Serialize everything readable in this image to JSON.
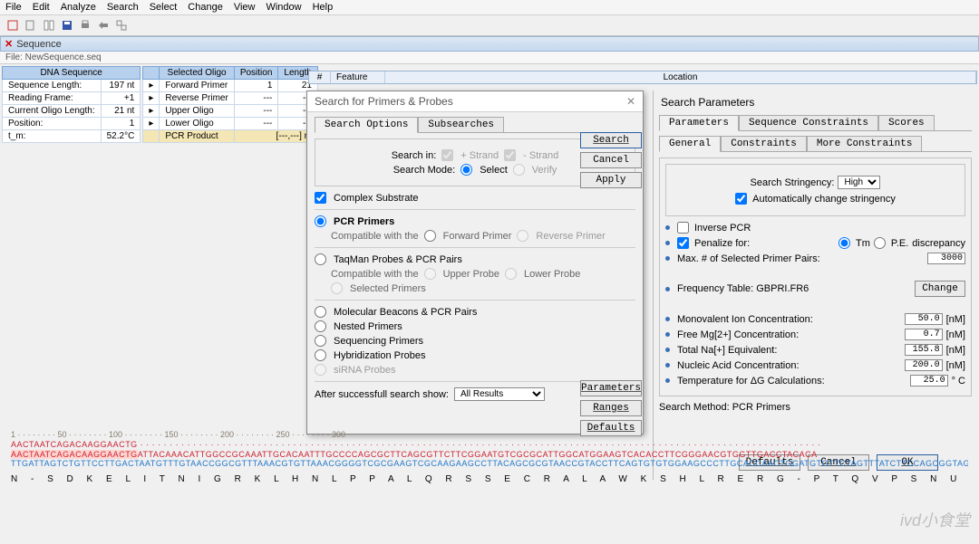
{
  "menu": [
    "File",
    "Edit",
    "Analyze",
    "Search",
    "Select",
    "Change",
    "View",
    "Window",
    "Help"
  ],
  "doc_title": "Sequence",
  "file_label": "File: NewSequence.seq",
  "dna_table": {
    "header": "DNA Sequence",
    "rows": [
      {
        "k": "Sequence Length:",
        "v": "197 nt"
      },
      {
        "k": "Reading Frame:",
        "v": "+1"
      },
      {
        "k": "Current Oligo Length:",
        "v": "21 nt"
      },
      {
        "k": "Position:",
        "v": "1"
      },
      {
        "k": "t_m:",
        "v": "52.2°C"
      }
    ]
  },
  "oligo_table": {
    "headers": [
      "Selected Oligo",
      "Position",
      "Length"
    ],
    "rows": [
      {
        "n": "Forward Primer",
        "p": "1",
        "l": "21"
      },
      {
        "n": "Reverse Primer",
        "p": "---",
        "l": "---"
      },
      {
        "n": "Upper Oligo",
        "p": "---",
        "l": "---"
      },
      {
        "n": "Lower Oligo",
        "p": "---",
        "l": "---"
      },
      {
        "n": "PCR Product",
        "p": "[---,---] nt",
        "l": ""
      }
    ]
  },
  "feat_headers": {
    "num": "#",
    "feature": "Feature",
    "location": "Location"
  },
  "dlg": {
    "title": "Search for Primers & Probes",
    "tab1": "Search Options",
    "tab2": "Subsearches",
    "search_in": "Search in:",
    "plus": "+ Strand",
    "minus": "- Strand",
    "search_mode": "Search Mode:",
    "select": "Select",
    "verify": "Verify",
    "complex": "Complex Substrate",
    "pcr_primers": "PCR Primers",
    "compat": "Compatible with the",
    "fwd": "Forward Primer",
    "rev": "Reverse Primer",
    "taqman": "TaqMan Probes & PCR Pairs",
    "upper": "Upper Probe",
    "lower": "Lower Probe",
    "selp": "Selected Primers",
    "mbeacons": "Molecular Beacons & PCR Pairs",
    "nested": "Nested Primers",
    "seqp": "Sequencing Primers",
    "hybp": "Hybridization Probes",
    "sirna": "siRNA Probes",
    "after": "After successfull search show:",
    "after_v": "All Results",
    "btn_search": "Search",
    "btn_cancel": "Cancel",
    "btn_apply": "Apply",
    "btn_params": "Parameters",
    "btn_ranges": "Ranges",
    "btn_defaults": "Defaults"
  },
  "sp": {
    "title": "Search Parameters",
    "tabs": [
      "Parameters",
      "Sequence Constraints",
      "Scores"
    ],
    "subtabs": [
      "General",
      "Constraints",
      "More Constraints"
    ],
    "stringency_l": "Search Stringency:",
    "stringency_v": "High",
    "auto": "Automatically change stringency",
    "inverse": "Inverse PCR",
    "penalize": "Penalize for:",
    "tm": "Tm",
    "pe": "P.E.",
    "disc": "discrepancy",
    "maxpairs": "Max. # of Selected Primer Pairs:",
    "maxpairs_v": "3000",
    "freq": "Frequency Table:  GBPRI.FR6",
    "change": "Change",
    "mono": "Monovalent Ion Concentration:",
    "mono_v": "50.0",
    "mono_u": "[nM]",
    "mg": "Free Mg[2+] Concentration:",
    "mg_v": "0.7",
    "mg_u": "[nM]",
    "na": "Total Na[+] Equivalent:",
    "na_v": "155.8",
    "na_u": "[nM]",
    "nucleic": "Nucleic Acid Concentration:",
    "nucleic_v": "200.0",
    "nucleic_u": "[nM]",
    "temp": "Temperature for ΔG Calculations:",
    "temp_v": "25.0",
    "temp_u": "° C",
    "method": "Search Method:  PCR Primers",
    "btn_def": "Defaults",
    "btn_can": "Cancel",
    "btn_ok": "OK"
  },
  "sequence": {
    "top": "AACTAATCAGACAAGGAACTG",
    "hl": "AACTAATCAGACAAGGAACTG",
    "line1_rest": "ATTACAAACATTGGCCGCAAATTGCACAATTTGCCCCAGCGCTTCAGCGTTCTTCGGAATGTCGCGCATTGGCATGGAAGTCACACCTTCGGGAACGTGGTTGACCTACACA",
    "line2_pre": "TTGATTAGTCTGTTCCTTGAC",
    "line2_rest": "TAATGTTTGTAACCGGCGTTTAAACGTGTTAAACGGGGTCGCGAAGTCGCAAGAAGCCTTACAGCGCGTAACCGTACCTTCAGTGTGTGGAAGCCCTTGCACCAACTGGATGTGT",
    "tail_blue": "TCTAGTTTATCTTCCAGCGGTAGTATTCGCCTCTTCTTCTGGTAGTTTTCTAGTTCAGTAAAACGACTTATTC",
    "aa": "N - S D K E L I T N I G R K L H N L P P A L Q R S S E C R A L A W K S H L R E R G - P T Q V P S N U M T K I Q Y     I K   S   C"
  },
  "watermark": "ivd小食堂"
}
